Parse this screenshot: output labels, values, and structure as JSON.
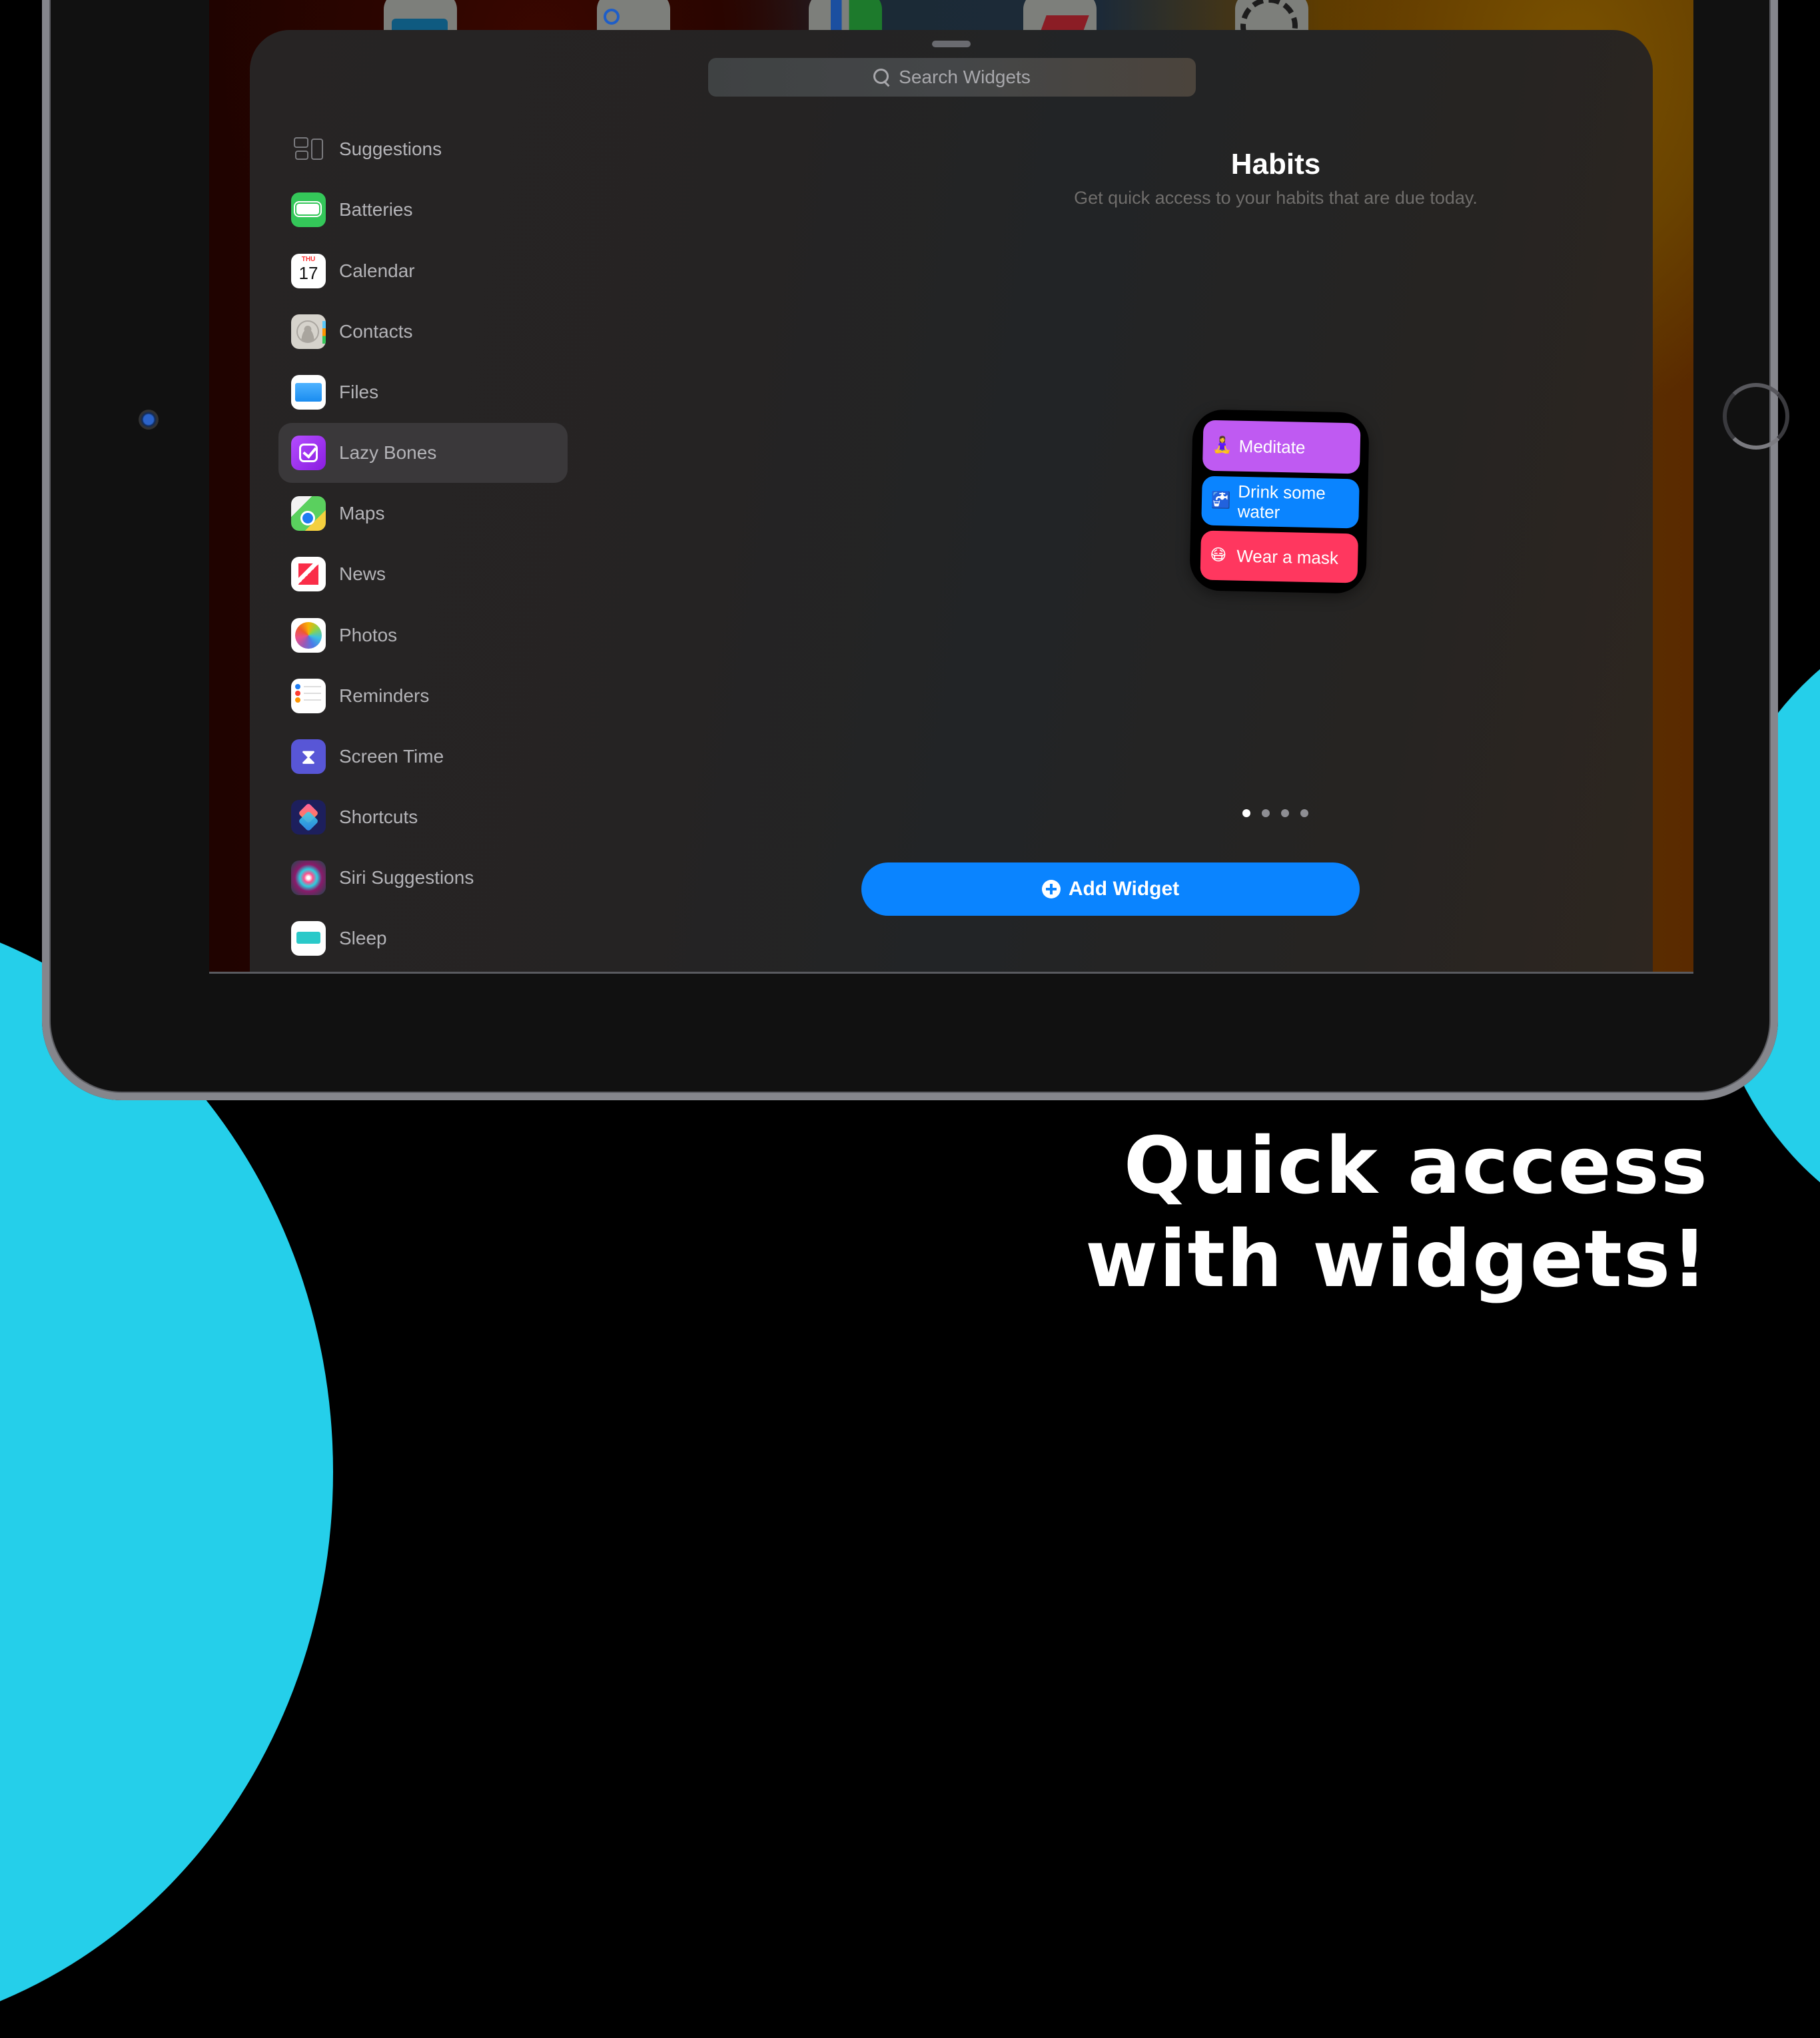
{
  "sheet": {
    "search": {
      "placeholder": "Search Widgets"
    }
  },
  "sidebar": {
    "items": [
      {
        "label": "Suggestions",
        "icon": "suggestions-icon"
      },
      {
        "label": "Batteries",
        "icon": "battery-icon"
      },
      {
        "label": "Calendar",
        "icon": "calendar-icon",
        "day": "THU",
        "date": "17"
      },
      {
        "label": "Contacts",
        "icon": "contacts-icon"
      },
      {
        "label": "Files",
        "icon": "folder-icon"
      },
      {
        "label": "Lazy Bones",
        "icon": "checkbox-icon",
        "selected": true
      },
      {
        "label": "Maps",
        "icon": "maps-icon"
      },
      {
        "label": "News",
        "icon": "news-icon"
      },
      {
        "label": "Photos",
        "icon": "photos-icon"
      },
      {
        "label": "Reminders",
        "icon": "reminders-icon"
      },
      {
        "label": "Screen Time",
        "icon": "hourglass-icon"
      },
      {
        "label": "Shortcuts",
        "icon": "shortcuts-icon"
      },
      {
        "label": "Siri Suggestions",
        "icon": "siri-icon"
      },
      {
        "label": "Sleep",
        "icon": "bed-icon"
      }
    ]
  },
  "preview": {
    "title": "Habits",
    "subtitle": "Get quick access to your habits that are due today.",
    "habits": [
      {
        "emoji": "🧘‍♀️",
        "label": "Meditate",
        "color": "#bf5af2"
      },
      {
        "emoji": "🚰",
        "label": "Drink some water",
        "color": "#0a84ff"
      },
      {
        "emoji": "😷",
        "label": "Wear a mask",
        "color": "#ff375f"
      }
    ],
    "page_count": 4,
    "current_page": 1,
    "add_button_label": "Add Widget"
  },
  "dock": [
    "Files",
    "Reminders",
    "Maps",
    "News",
    "Settings"
  ],
  "tagline": {
    "line1": "Quick access",
    "line2": "with widgets!"
  },
  "colors": {
    "accent": "#0a84ff",
    "background_blob": "#25cfea"
  }
}
